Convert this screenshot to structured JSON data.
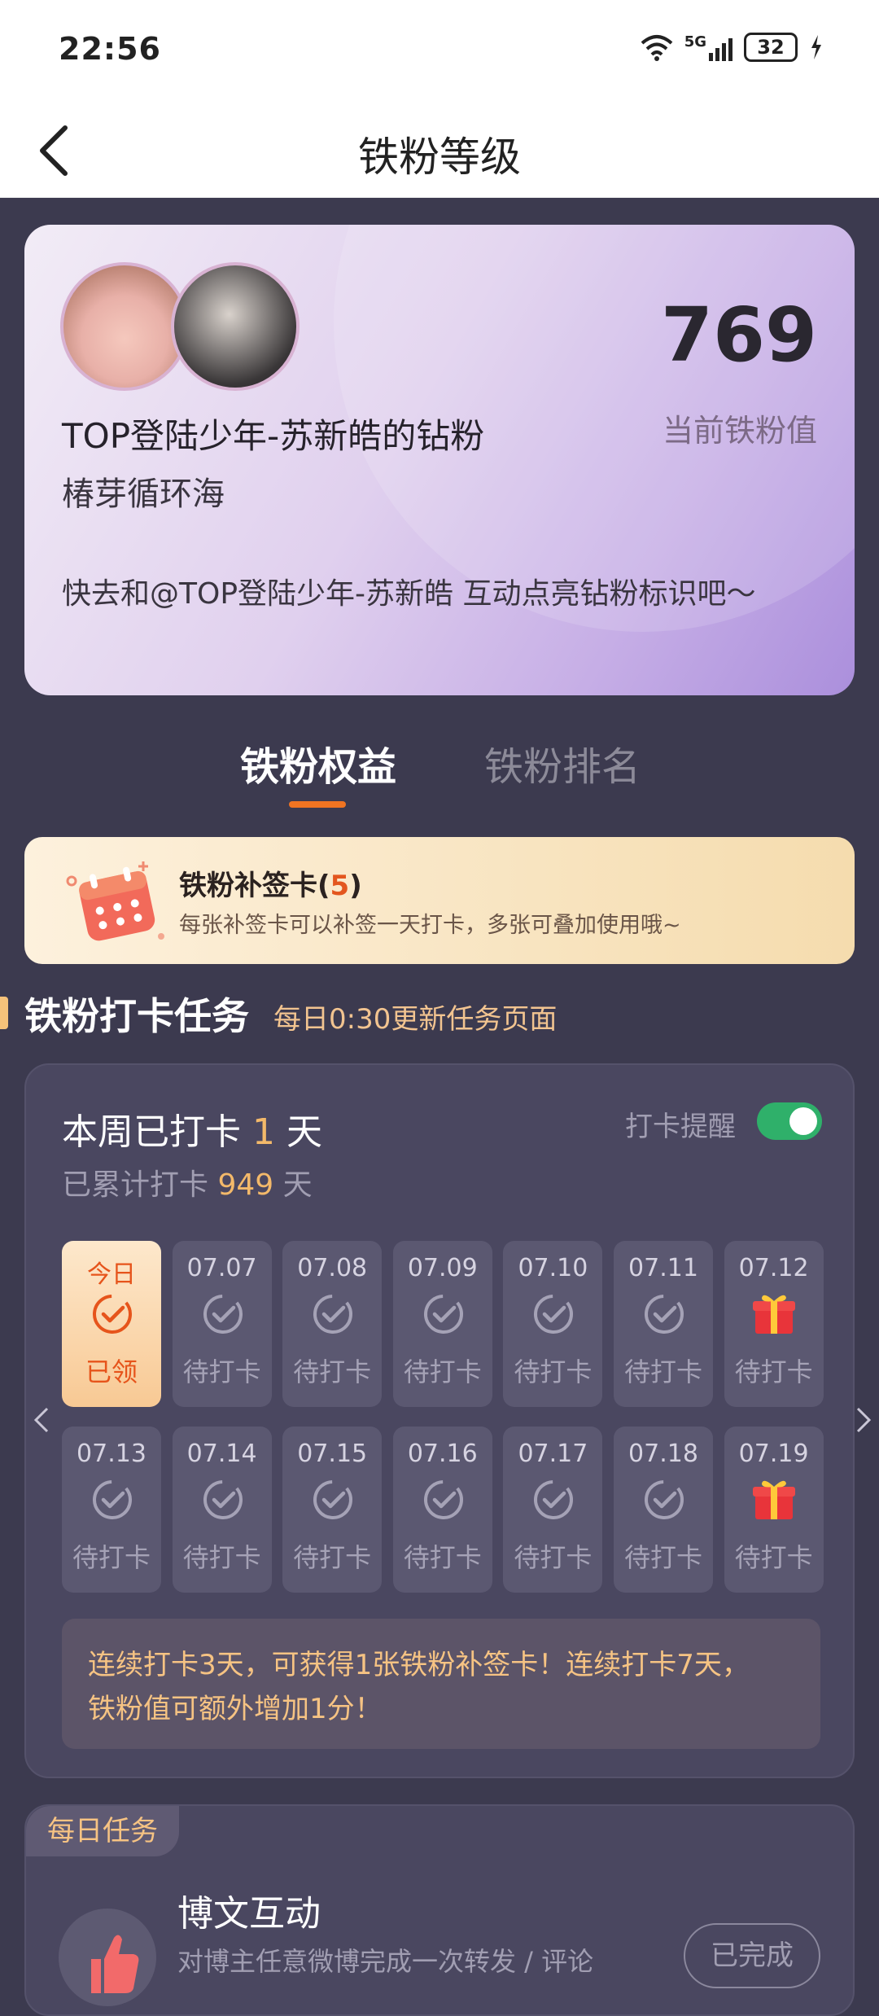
{
  "status_bar": {
    "time": "22:56",
    "battery": "32",
    "network": "5G"
  },
  "nav": {
    "title": "铁粉等级"
  },
  "profile": {
    "name": "TOP登陆少年-苏新皓的钻粉",
    "nickname": "椿芽循环海",
    "score": "769",
    "score_label": "当前铁粉值",
    "tip": "快去和@TOP登陆少年-苏新皓 互动点亮钻粉标识吧～"
  },
  "tabs": [
    {
      "label": "铁粉权益",
      "active": true
    },
    {
      "label": "铁粉排名",
      "active": false
    }
  ],
  "supplement": {
    "title": "铁粉补签卡",
    "count": "5",
    "description": "每张补签卡可以补签一天打卡，多张可叠加使用哦~"
  },
  "section": {
    "title": "铁粉打卡任务",
    "subtitle": "每日0:30更新任务页面"
  },
  "checkin": {
    "week_prefix": "本周已打卡",
    "week_days": "1",
    "week_suffix": "天",
    "total_prefix": "已累计打卡",
    "total_days": "949",
    "total_suffix": "天",
    "reminder_label": "打卡提醒",
    "reminder_on": true,
    "days_row1": [
      {
        "date": "今日",
        "status": "已领",
        "type": "today"
      },
      {
        "date": "07.07",
        "status": "待打卡",
        "type": "check"
      },
      {
        "date": "07.08",
        "status": "待打卡",
        "type": "check"
      },
      {
        "date": "07.09",
        "status": "待打卡",
        "type": "check"
      },
      {
        "date": "07.10",
        "status": "待打卡",
        "type": "check"
      },
      {
        "date": "07.11",
        "status": "待打卡",
        "type": "check"
      },
      {
        "date": "07.12",
        "status": "待打卡",
        "type": "gift"
      }
    ],
    "days_row2": [
      {
        "date": "07.13",
        "status": "待打卡",
        "type": "check"
      },
      {
        "date": "07.14",
        "status": "待打卡",
        "type": "check"
      },
      {
        "date": "07.15",
        "status": "待打卡",
        "type": "check"
      },
      {
        "date": "07.16",
        "status": "待打卡",
        "type": "check"
      },
      {
        "date": "07.17",
        "status": "待打卡",
        "type": "check"
      },
      {
        "date": "07.18",
        "status": "待打卡",
        "type": "check"
      },
      {
        "date": "07.19",
        "status": "待打卡",
        "type": "gift"
      }
    ],
    "streak_tip_line1": "连续打卡3天，可获得1张铁粉补签卡！连续打卡7天，",
    "streak_tip_line2": "铁粉值可额外增加1分！"
  },
  "daily_tasks": {
    "tag": "每日任务",
    "task": {
      "title": "博文互动",
      "description": "对博主任意微博完成一次转发 / 评论",
      "button": "已完成",
      "icon": "thumbs-up-icon"
    }
  },
  "colors": {
    "accent": "#f07422",
    "highlight": "#f3b96a",
    "toggle_on": "#2fb06a",
    "page_bg": "#3c3a4f"
  }
}
